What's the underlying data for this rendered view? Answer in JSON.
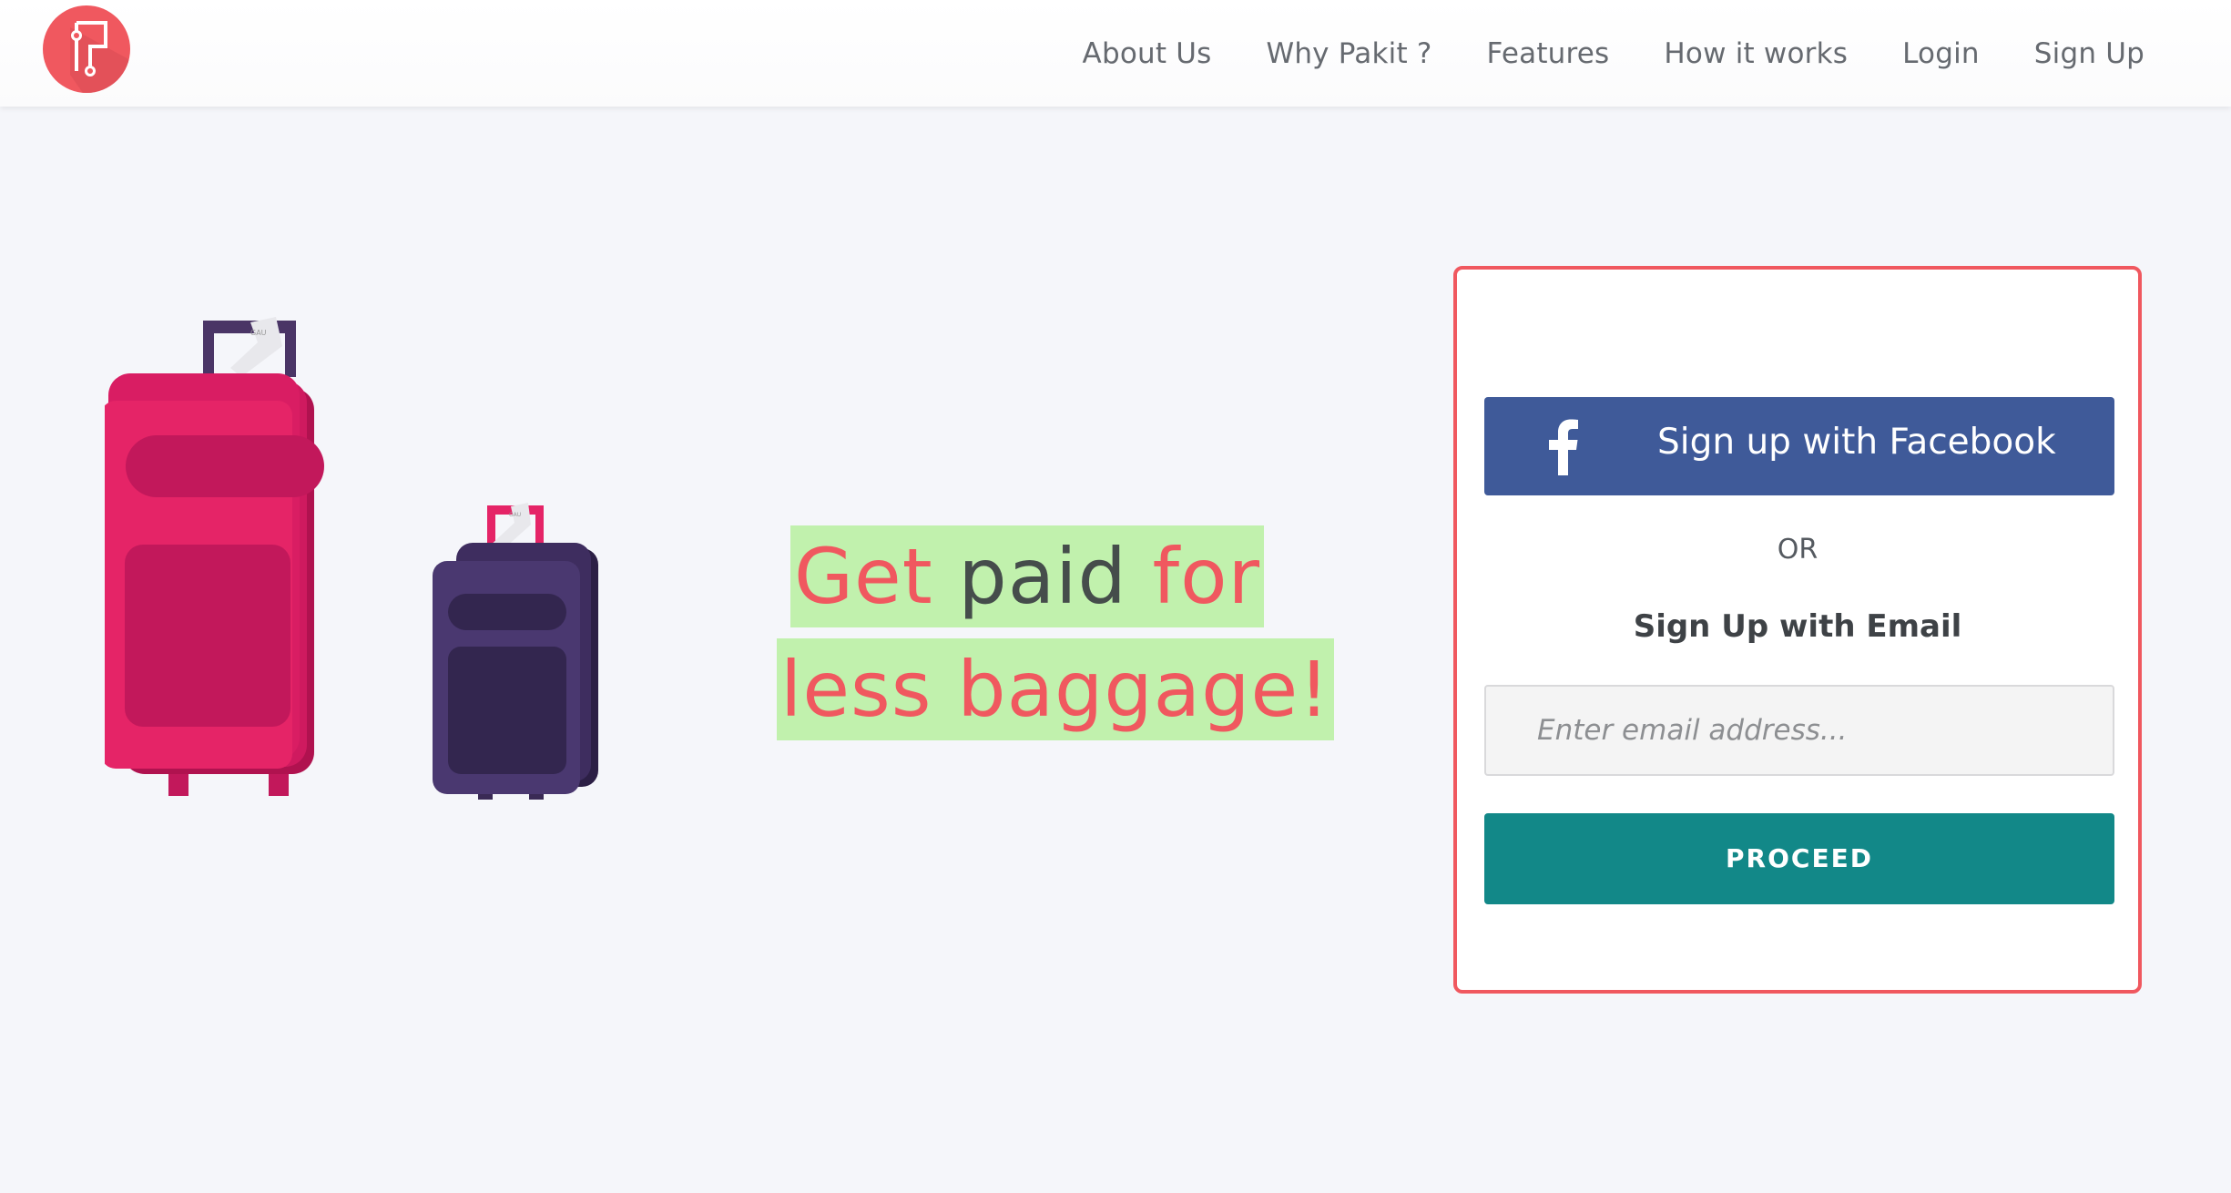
{
  "brand": {
    "logo_icon": "pakit-logo-icon",
    "accent_color": "#f0585f"
  },
  "nav": {
    "items": [
      {
        "label": "About Us"
      },
      {
        "label": "Why Pakit ?"
      },
      {
        "label": "Features"
      },
      {
        "label": "How it works"
      },
      {
        "label": "Login"
      },
      {
        "label": "Sign Up"
      }
    ]
  },
  "hero": {
    "illustration_icon": "luggage-illustration",
    "tagline": {
      "line1": {
        "part1": "Get",
        "part2": "paid",
        "part3": "for"
      },
      "line2": "less baggage!"
    },
    "highlight_color": "#c1f1ad"
  },
  "signup": {
    "facebook_button_label": "Sign up with Facebook",
    "facebook_icon": "facebook-icon",
    "facebook_color": "#3f5a99",
    "or_text": "OR",
    "email_title": "Sign Up with Email",
    "email_placeholder": "Enter email address...",
    "email_value": "",
    "proceed_label": "PROCEED",
    "proceed_color": "#128888"
  }
}
